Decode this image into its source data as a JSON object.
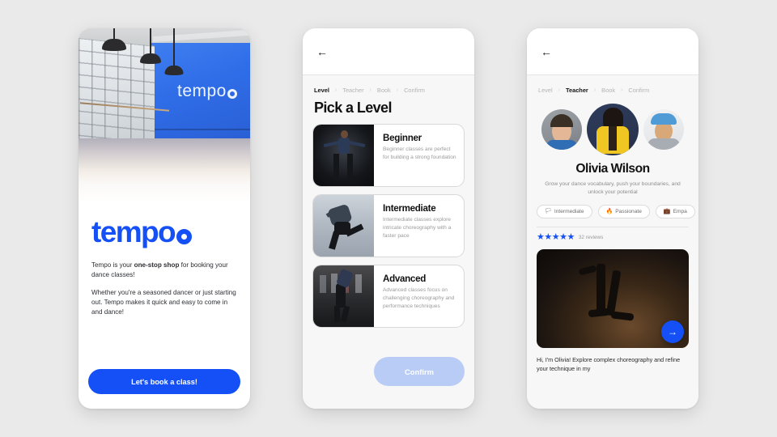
{
  "background_color": "#eaeaea",
  "accent_color": "#1450f5",
  "screen1": {
    "hero": {
      "wall_logo": "tempo",
      "alt": "dance-studio-photo"
    },
    "brand": "tempo",
    "paragraph1_pre": "Tempo is your ",
    "paragraph1_bold": "one-stop shop",
    "paragraph1_post": " for booking your dance classes!",
    "paragraph2": "Whether you're a seasoned dancer or just starting out. Tempo makes it quick and easy to come in and dance!",
    "cta_label": "Let's book a class!"
  },
  "screen2": {
    "back_icon": "←",
    "breadcrumbs": [
      {
        "label": "Level",
        "active": true
      },
      {
        "label": "Teacher",
        "active": false
      },
      {
        "label": "Book",
        "active": false
      },
      {
        "label": "Confirm",
        "active": false
      }
    ],
    "separator": "›",
    "title": "Pick a Level",
    "levels": [
      {
        "name": "Beginner",
        "desc": "Beginner classes are perfect for building a strong foundation"
      },
      {
        "name": "Intermediate",
        "desc": "Intermediate classes explore intricate choreography with a faster pace"
      },
      {
        "name": "Advanced",
        "desc": "Advanced classes focus on challenging choreography and performance techniques"
      }
    ],
    "confirm_label": "Confirm"
  },
  "screen3": {
    "back_icon": "←",
    "breadcrumbs": [
      {
        "label": "Level",
        "active": false
      },
      {
        "label": "Teacher",
        "active": true
      },
      {
        "label": "Book",
        "active": false
      },
      {
        "label": "Confirm",
        "active": false
      }
    ],
    "separator": "›",
    "teacher_name": "Olivia Wilson",
    "teacher_bio": "Grow your dance vocabulary, push your boundaries, and unlock your potential",
    "chips": [
      {
        "icon": "🏳",
        "label": "Intermediate"
      },
      {
        "icon": "🔥",
        "label": "Passionate"
      },
      {
        "icon": "💼",
        "label": "Empa"
      }
    ],
    "stars": "★★★★★",
    "reviews": "32 reviews",
    "video_alt": "dancer-silhouette-video",
    "fab_icon": "→",
    "note": "Hi, I'm Olivia! Explore complex choreography and refine your technique in my"
  }
}
